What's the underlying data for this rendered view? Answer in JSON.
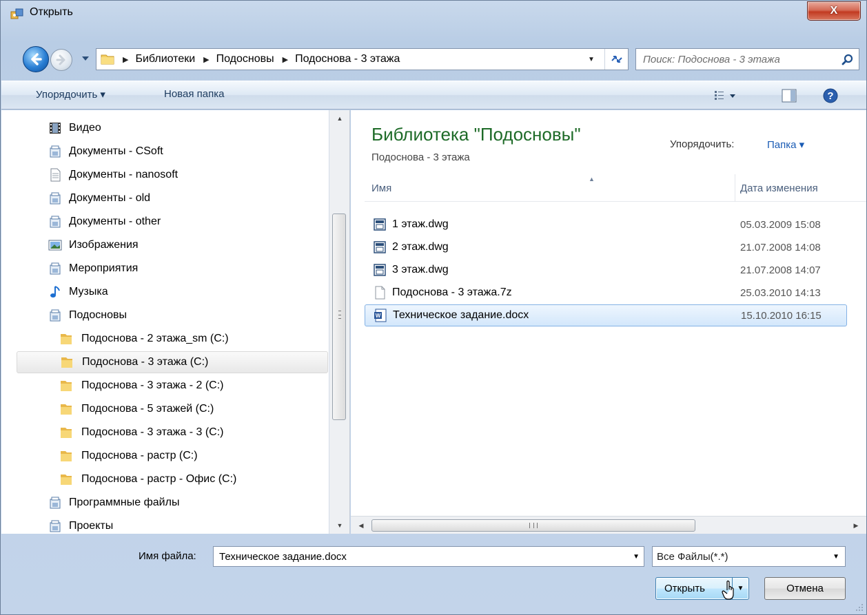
{
  "window": {
    "title": "Открыть",
    "close_symbol": "X"
  },
  "navigation": {
    "back_icon": "back-arrow-icon",
    "forward_icon": "forward-arrow-icon",
    "breadcrumb": [
      "Библиотеки",
      "Подосновы",
      "Подоснова - 3 этажа"
    ],
    "search_placeholder": "Поиск: Подоснова - 3 этажа"
  },
  "toolbar": {
    "organize_label": "Упорядочить ▾",
    "new_folder_label": "Новая папка"
  },
  "sidebar": {
    "items": [
      {
        "label": "Видео",
        "icon": "video-library-icon",
        "level": 0
      },
      {
        "label": "Документы - CSoft",
        "icon": "library-icon",
        "level": 0
      },
      {
        "label": "Документы - nanosoft",
        "icon": "document-icon",
        "level": 0
      },
      {
        "label": "Документы - old",
        "icon": "library-icon",
        "level": 0
      },
      {
        "label": "Документы - other",
        "icon": "library-icon",
        "level": 0
      },
      {
        "label": "Изображения",
        "icon": "pictures-library-icon",
        "level": 0
      },
      {
        "label": "Мероприятия",
        "icon": "library-icon",
        "level": 0
      },
      {
        "label": "Музыка",
        "icon": "music-library-icon",
        "level": 0
      },
      {
        "label": "Подосновы",
        "icon": "library-icon",
        "level": 0
      },
      {
        "label": "Подоснова - 2 этажа_sm (C:)",
        "icon": "folder-icon",
        "level": 1
      },
      {
        "label": "Подоснова - 3 этажа (C:)",
        "icon": "folder-icon",
        "level": 1,
        "selected": true
      },
      {
        "label": "Подоснова - 3 этажа - 2 (C:)",
        "icon": "folder-icon",
        "level": 1
      },
      {
        "label": "Подоснова - 5 этажей (C:)",
        "icon": "folder-icon",
        "level": 1
      },
      {
        "label": "Подоснова - 3 этажа - 3 (C:)",
        "icon": "folder-icon",
        "level": 1
      },
      {
        "label": "Подоснова - растр (C:)",
        "icon": "folder-icon",
        "level": 1
      },
      {
        "label": "Подоснова - растр - Офис (C:)",
        "icon": "folder-icon",
        "level": 1
      },
      {
        "label": "Программные файлы",
        "icon": "library-icon",
        "level": 0
      },
      {
        "label": "Проекты",
        "icon": "library-icon",
        "level": 0
      }
    ]
  },
  "main": {
    "library_title": "Библиотека \"Подосновы\"",
    "library_subtitle": "Подоснова - 3 этажа",
    "arrange_label": "Упорядочить:",
    "arrange_value": "Папка ▾",
    "columns": {
      "name": "Имя",
      "date": "Дата изменения"
    },
    "files": [
      {
        "name": "1 этаж.dwg",
        "date": "05.03.2009 15:08",
        "icon": "dwg-file-icon"
      },
      {
        "name": "2 этаж.dwg",
        "date": "21.07.2008 14:08",
        "icon": "dwg-file-icon"
      },
      {
        "name": "3 этаж.dwg",
        "date": "21.07.2008 14:07",
        "icon": "dwg-file-icon"
      },
      {
        "name": "Подоснова - 3 этажа.7z",
        "date": "25.03.2010 14:13",
        "icon": "blank-file-icon"
      },
      {
        "name": "Техническое задание.docx",
        "date": "15.10.2010 16:15",
        "icon": "word-document-icon",
        "selected": true
      }
    ]
  },
  "bottom": {
    "filename_label": "Имя файла:",
    "filename_value": "Техническое задание.docx",
    "filter_value": "Все Файлы(*.*)",
    "open_label": "Открыть",
    "cancel_label": "Отмена"
  },
  "colors": {
    "library_title": "#1e6b28",
    "selection_border": "#83b1e5",
    "link_blue": "#1a5bb4"
  }
}
